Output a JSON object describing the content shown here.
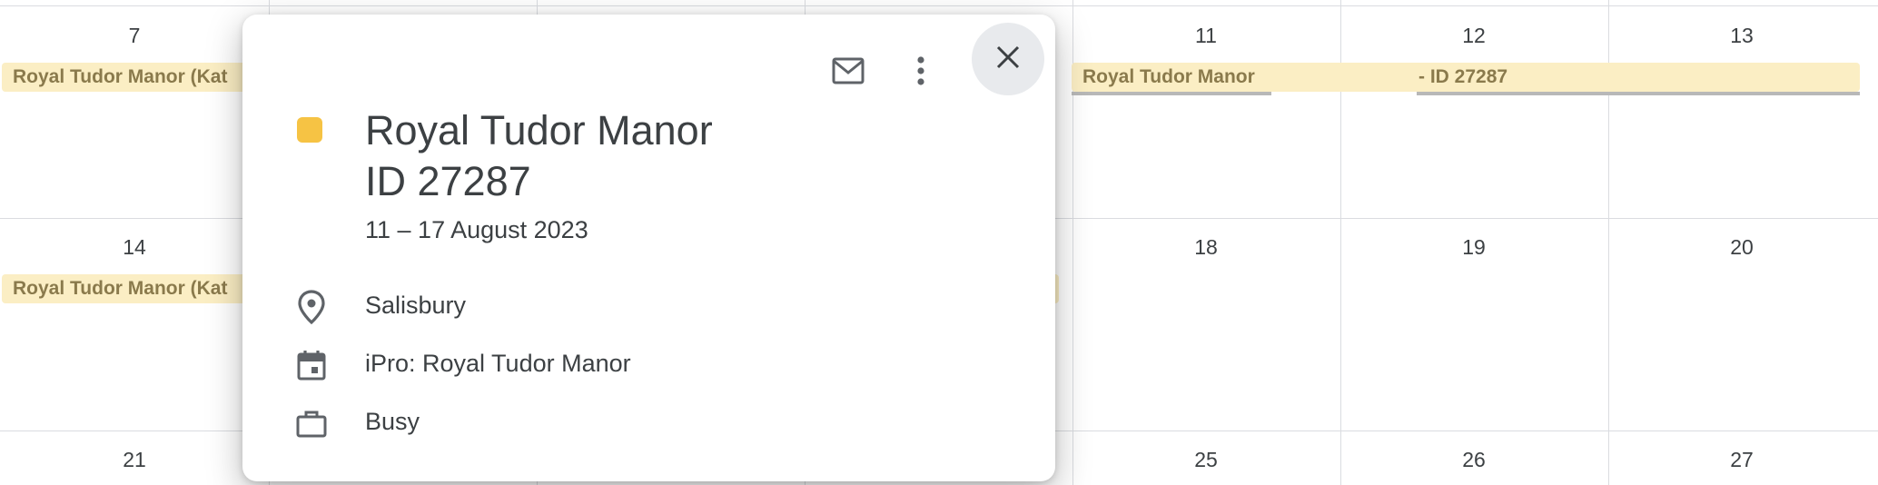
{
  "calendar": {
    "week_rows": [
      {
        "days": [
          "7",
          "11",
          "12",
          "13"
        ]
      },
      {
        "days": [
          "14",
          "18",
          "19",
          "20"
        ]
      },
      {
        "days": [
          "21",
          "25",
          "26",
          "27"
        ]
      }
    ],
    "events": {
      "row1_left": "Royal Tudor Manor (Kat",
      "row1_right_a": "Royal Tudor Manor",
      "row1_right_b": "- ID 27287",
      "row2_left": "Royal Tudor Manor (Kat"
    }
  },
  "popup": {
    "title_line1": "Royal Tudor Manor",
    "title_line2": "ID 27287",
    "date_range": "11 – 17 August 2023",
    "location": "Salisbury",
    "calendar_name": "iPro: Royal Tudor Manor",
    "availability": "Busy",
    "event_color": "#f6c344",
    "icons": {
      "email": "email-icon",
      "more": "more-options-icon",
      "close": "close-icon",
      "location": "location-pin-icon",
      "calendar": "calendar-icon",
      "availability": "briefcase-icon"
    }
  },
  "colors": {
    "event_chip_bg": "#fbeec4",
    "event_chip_text": "#8a7a4c",
    "grid_line": "#dadce0"
  }
}
